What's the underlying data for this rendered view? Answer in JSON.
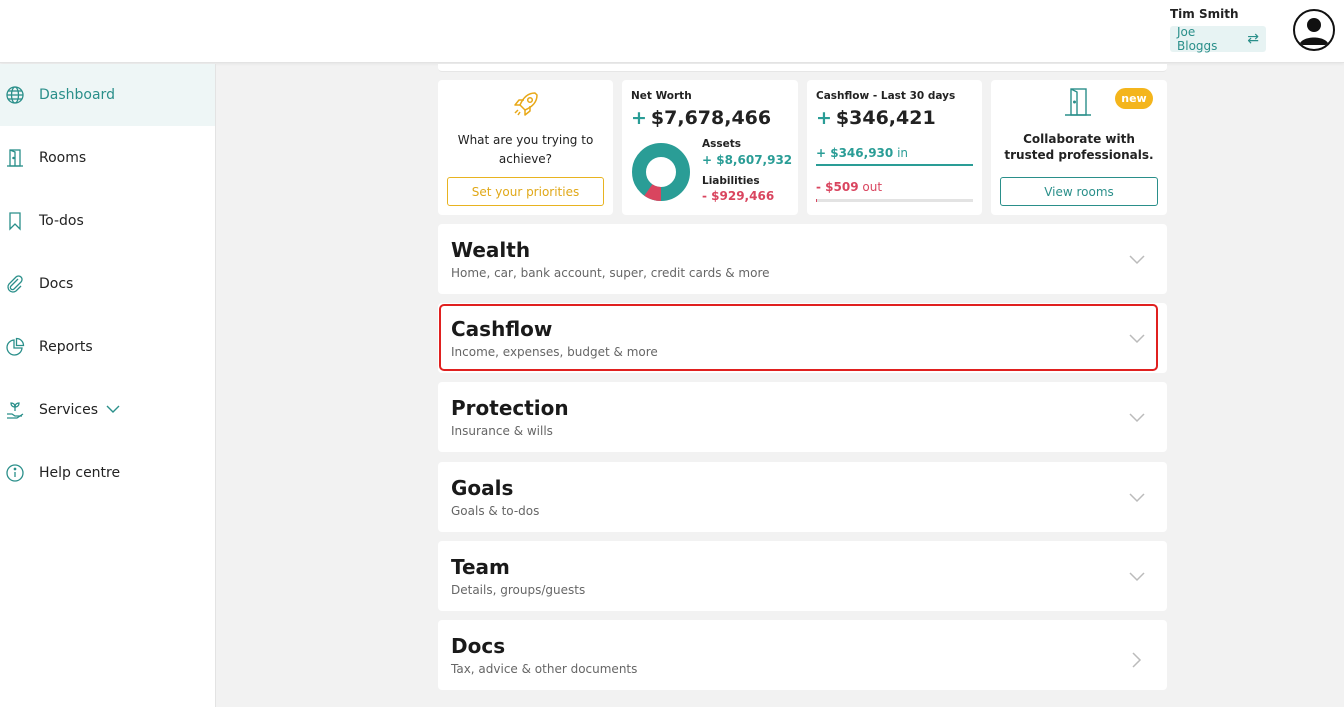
{
  "header": {
    "user_name": "Tim Smith",
    "switch_account": "Joe Bloggs",
    "switch_icon": "swap-arrows-icon"
  },
  "sidebar": {
    "items": [
      {
        "label": "Dashboard",
        "icon": "globe-icon",
        "active": true
      },
      {
        "label": "Rooms",
        "icon": "door-icon"
      },
      {
        "label": "To-dos",
        "icon": "bookmark-icon"
      },
      {
        "label": "Docs",
        "icon": "paperclip-icon"
      },
      {
        "label": "Reports",
        "icon": "pie-chart-icon"
      },
      {
        "label": "Services",
        "icon": "hand-plant-icon"
      },
      {
        "label": "Help centre",
        "icon": "info-icon"
      }
    ]
  },
  "cards": {
    "priorities": {
      "text": "What are you trying to achieve?",
      "button": "Set your priorities",
      "icon": "rocket-icon"
    },
    "net_worth": {
      "title": "Net Worth",
      "sign": "+",
      "value": "$7,678,466",
      "assets_label": "Assets",
      "assets_value": "+ $8,607,932",
      "liabilities_label": "Liabilities",
      "liabilities_value": "- $929,466",
      "assets_share": 0.9026,
      "liabilities_share": 0.0974
    },
    "cashflow": {
      "title": "Cashflow - Last 30 days",
      "sign": "+",
      "value": "$346,421",
      "in_value": "+ $346,930",
      "in_label": "in",
      "out_value": "- $509",
      "out_label": "out"
    },
    "collaborate": {
      "badge": "new",
      "text": "Collaborate with trusted professionals.",
      "button": "View rooms",
      "icon": "door-icon"
    }
  },
  "sections": [
    {
      "title": "Wealth",
      "subtitle": "Home, car, bank account, super, credit cards & more",
      "icon": "chevron-down-icon"
    },
    {
      "title": "Cashflow",
      "subtitle": "Income, expenses, budget & more",
      "icon": "chevron-down-icon"
    },
    {
      "title": "Protection",
      "subtitle": "Insurance & wills",
      "icon": "chevron-down-icon"
    },
    {
      "title": "Goals",
      "subtitle": "Goals & to-dos",
      "icon": "chevron-down-icon"
    },
    {
      "title": "Team",
      "subtitle": "Details, groups/guests",
      "icon": "chevron-down-icon"
    },
    {
      "title": "Docs",
      "subtitle": "Tax, advice & other documents",
      "icon": "chevron-right-icon"
    }
  ],
  "colors": {
    "teal": "#2a9d96",
    "red": "#d9455f",
    "yellow": "#f4b51c",
    "highlight": "#e0201f"
  }
}
